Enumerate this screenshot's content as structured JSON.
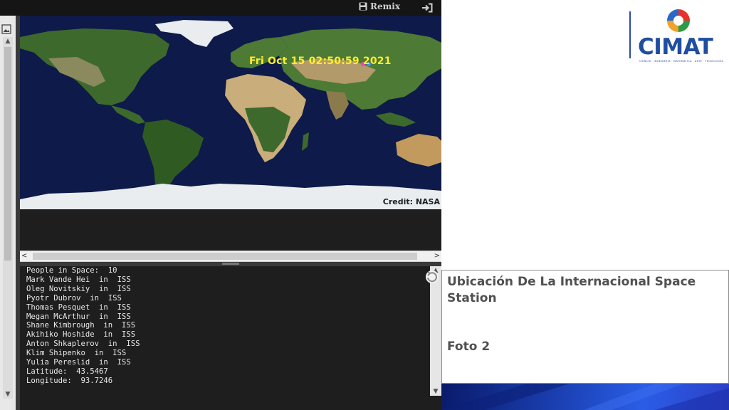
{
  "toolbar": {
    "remix_label": "Remix",
    "remix_icon": "save-icon",
    "login_icon": "sign-in-icon"
  },
  "map": {
    "timestamp": "Fri Oct 15 02:50:59 2021",
    "credit": "Credit: NASA",
    "ocean_color": "#0e1a49",
    "land_color": "#3d6a2c",
    "desert_color": "#c9ad7a",
    "ice_color": "#e9edef"
  },
  "console": {
    "lines": [
      "People in Space:  10",
      "Mark Vande Hei  in  ISS",
      "Oleg Novitskiy  in  ISS",
      "Pyotr Dubrov  in  ISS",
      "Thomas Pesquet  in  ISS",
      "Megan McArthur  in  ISS",
      "Shane Kimbrough  in  ISS",
      "Akihiko Hoshide  in  ISS",
      "Anton Shkaplerov  in  ISS",
      "Klim Shipenko  in  ISS",
      "Yulia Pereslid  in  ISS",
      "Latitude:  43.5467",
      "Longitude:  93.7246"
    ]
  },
  "slide": {
    "logo_text": "CIMAT",
    "logo_tagline": "CIENCIA · INGENIERÍA · MATEMÁTICA · ARTE · TECNOLOGÍA",
    "caption_title": "Ubicación De La Internacional Space Station",
    "caption_subtitle": "Foto 2",
    "accent_color": "#1f4ea0"
  }
}
